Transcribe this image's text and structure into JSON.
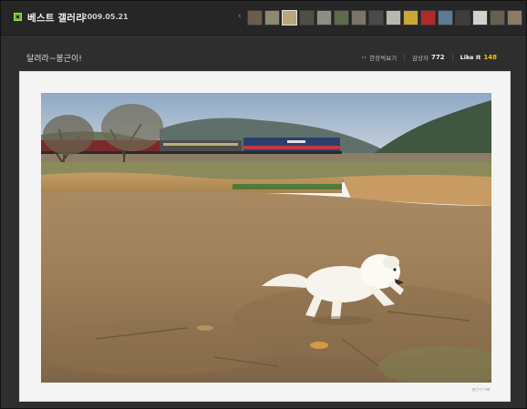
{
  "header": {
    "title": "베스트 갤러리",
    "date": "2009.05.21",
    "prev_arrow": "‹",
    "thumbnails": [
      {
        "color": "#6b5c4d",
        "active": false
      },
      {
        "color": "#8c8a6e",
        "active": false
      },
      {
        "color": "#b9a77a",
        "active": true
      },
      {
        "color": "#4f4f45",
        "active": false
      },
      {
        "color": "#8d8d85",
        "active": false
      },
      {
        "color": "#5e6b4c",
        "active": false
      },
      {
        "color": "#7a746b",
        "active": false
      },
      {
        "color": "#4a4a4a",
        "active": false
      },
      {
        "color": "#b8b8b0",
        "active": false
      },
      {
        "color": "#c8a832",
        "active": false
      },
      {
        "color": "#b02a2a",
        "active": false
      },
      {
        "color": "#5c7a91",
        "active": false
      },
      {
        "color": "#3d3d3d",
        "active": false
      },
      {
        "color": "#d2d2cc",
        "active": false
      },
      {
        "color": "#66604f",
        "active": false
      },
      {
        "color": "#8a7a66",
        "active": false
      }
    ]
  },
  "post": {
    "title": "달려라~봉근이!",
    "fullscreen_label": "한장씩보기",
    "views_label": "감상자",
    "views_count": "772",
    "like_label": "Like It",
    "like_count": "148"
  },
  "photo": {
    "caption_signature": "봉근이 아빠"
  },
  "colors": {
    "accent_green": "#6fb52c",
    "like_yellow": "#f2c200",
    "background": "#2e2e2e",
    "card": "#f4f4f4"
  }
}
